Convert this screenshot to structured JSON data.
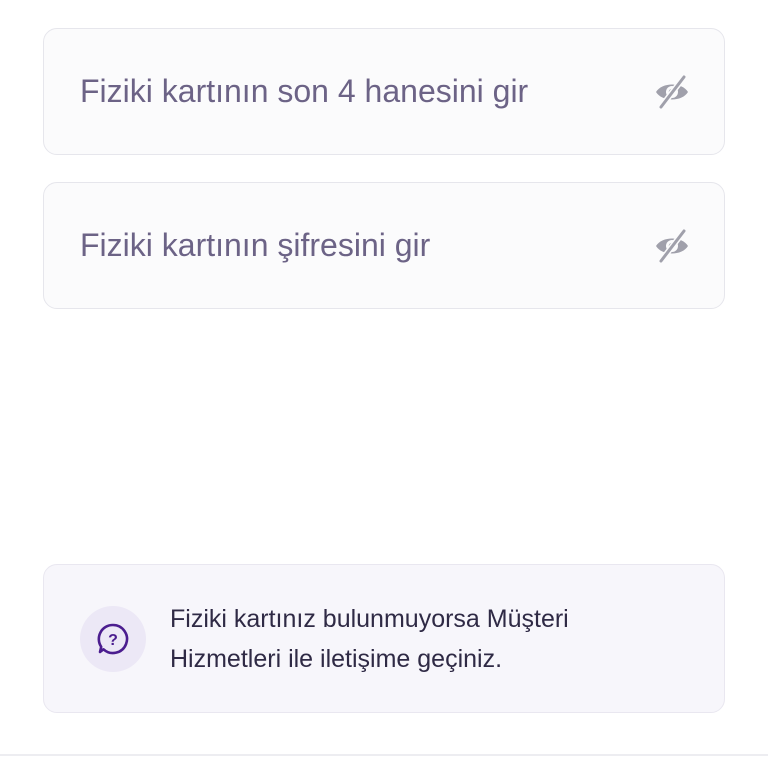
{
  "form": {
    "last4_field": {
      "placeholder": "Fiziki kartının son 4 hanesini gir",
      "value": "",
      "toggle_icon": "eye-off-icon"
    },
    "pin_field": {
      "placeholder": "Fiziki kartının şifresini gir",
      "value": "",
      "toggle_icon": "eye-off-icon"
    }
  },
  "info": {
    "icon": "help-chat-icon",
    "text": "Fiziki kartınız bulunmuyorsa Müşteri Hizmetleri ile iletişime geçiniz."
  },
  "colors": {
    "accent": "#4b1d8f",
    "placeholder": "#6c6386",
    "icon_muted": "#9a9aa6"
  }
}
